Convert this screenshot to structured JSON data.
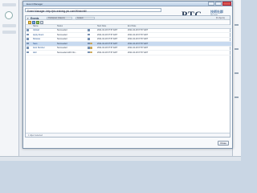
{
  "window": {
    "title": "Event Manager",
    "url": "Event Manager: http://ptc-training.ptc.com/Windchill/"
  },
  "logo": {
    "brand": "PTC",
    "sub": "技術社群",
    "sub2": "ptc.com"
  },
  "panel": {
    "title": "Events",
    "filter1": "Participant (Fatemi)",
    "filter2": "Default",
    "count": "(5 objects)"
  },
  "table": {
    "columns": [
      "",
      "Name",
      "Status",
      "",
      "Start Date",
      "End Date",
      ""
    ],
    "rows": [
      {
        "name": "Upload",
        "status": "Succeeded",
        "start": "2011-04-18 07:57 EDT",
        "end": "2011-04-18 07:57 EDT",
        "selected": false
      },
      {
        "name": "Apply Event",
        "status": "Succeeded",
        "start": "2011-04-18 07:57 EDT",
        "end": "2011-04-18 07:57 EDT",
        "selected": false
      },
      {
        "name": "Release",
        "status": "Succeeded",
        "start": "2011-04-18 07:57 EDT",
        "end": "2011-04-18 07:57 EDT",
        "selected": false
      },
      {
        "name": "Save",
        "status": "Succeeded",
        "start": "2011-04-18 07:57 EDT",
        "end": "2011-04-18 07:57 EDT",
        "selected": true
      },
      {
        "name": "Auto Number",
        "status": "Succeeded",
        "start": "2011-04-18 07:57 EDT",
        "end": "2011-04-18 07:57 EDT",
        "selected": false
      },
      {
        "name": "Add",
        "status": "Succeeded with Info...",
        "start": "2011-04-18 07:57 EDT",
        "end": "2011-04-18 07:57 EDT",
        "selected": false
      }
    ]
  },
  "footer": {
    "selection": "1 object selected"
  },
  "buttons": {
    "close": "Close"
  }
}
